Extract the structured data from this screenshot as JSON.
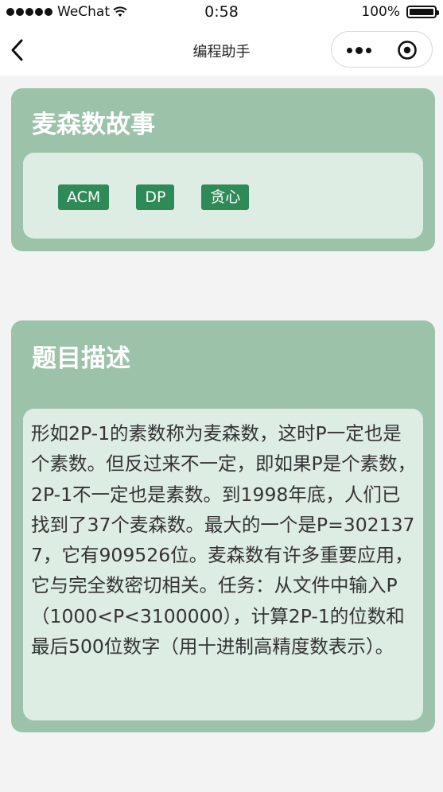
{
  "status_bar": {
    "carrier": "WeChat",
    "time": "0:58",
    "battery": "100%"
  },
  "nav": {
    "title": "编程助手"
  },
  "problem": {
    "title": "麦森数故事",
    "tags": [
      "ACM",
      "DP",
      "贪心"
    ]
  },
  "description": {
    "heading": "题目描述",
    "text": "形如2P-1的素数称为麦森数，这时P一定也是个素数。但反过来不一定，即如果P是个素数，2P-1不一定也是素数。到1998年底，人们已找到了37个麦森数。最大的一个是P=3021377，它有909526位。麦森数有许多重要应用，它与完全数密切相关。任务：从文件中输入P（1000<P<3100000），计算2P-1的位数和最后500位数字（用十进制高精度数表示）。"
  },
  "colors": {
    "card_bg": "#9cc3a9",
    "inner_bg": "#deede3",
    "tag_bg": "#2e8b57"
  }
}
